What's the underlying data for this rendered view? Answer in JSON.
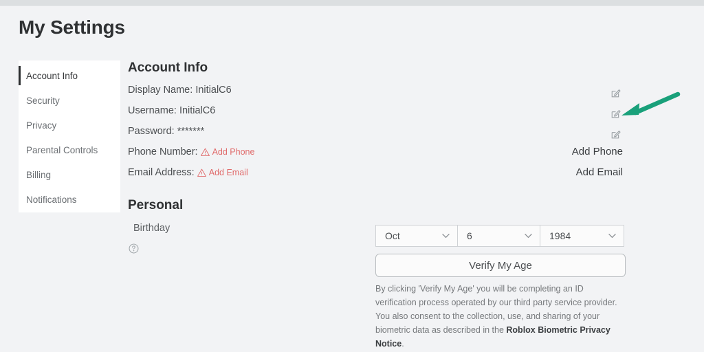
{
  "page": {
    "title": "My Settings"
  },
  "sidebar": {
    "items": [
      {
        "label": "Account Info",
        "active": true
      },
      {
        "label": "Security",
        "active": false
      },
      {
        "label": "Privacy",
        "active": false
      },
      {
        "label": "Parental Controls",
        "active": false
      },
      {
        "label": "Billing",
        "active": false
      },
      {
        "label": "Notifications",
        "active": false
      }
    ]
  },
  "account_info": {
    "heading": "Account Info",
    "display_name_label": "Display Name:",
    "display_name_value": "InitialC6",
    "username_label": "Username:",
    "username_value": "InitialC6",
    "password_label": "Password:",
    "password_value": "*******",
    "phone_label": "Phone Number:",
    "phone_action": "Add Phone",
    "email_label": "Email Address:",
    "email_action": "Add Email",
    "right_actions": {
      "add_phone": "Add Phone",
      "add_email": "Add Email"
    },
    "icons": {
      "edit_display_name": "edit-pencil-square-icon",
      "edit_username": "edit-pencil-square-icon",
      "edit_password": "edit-pencil-square-icon",
      "phone_warning": "warning-triangle-icon",
      "email_warning": "warning-triangle-icon"
    }
  },
  "personal": {
    "heading": "Personal",
    "birthday_label": "Birthday",
    "help_icon": "question-mark-circle-icon",
    "birthday": {
      "month": "Oct",
      "day": "6",
      "year": "1984"
    },
    "verify_button": "Verify My Age",
    "disclaimer_text": "By clicking 'Verify My Age' you will be completing an ID verification process operated by our third party service provider. You also consent to the collection, use, and sharing of your biometric data as described in the ",
    "disclaimer_link": "Roblox Biometric Privacy Notice",
    "disclaimer_end": "."
  },
  "annotation": {
    "arrow_color": "#19a07a",
    "points_to": "edit-username-icon"
  },
  "colors": {
    "background": "#f2f3f5",
    "panel": "#ffffff",
    "warning": "#e06a6a",
    "title": "#2f3133"
  }
}
